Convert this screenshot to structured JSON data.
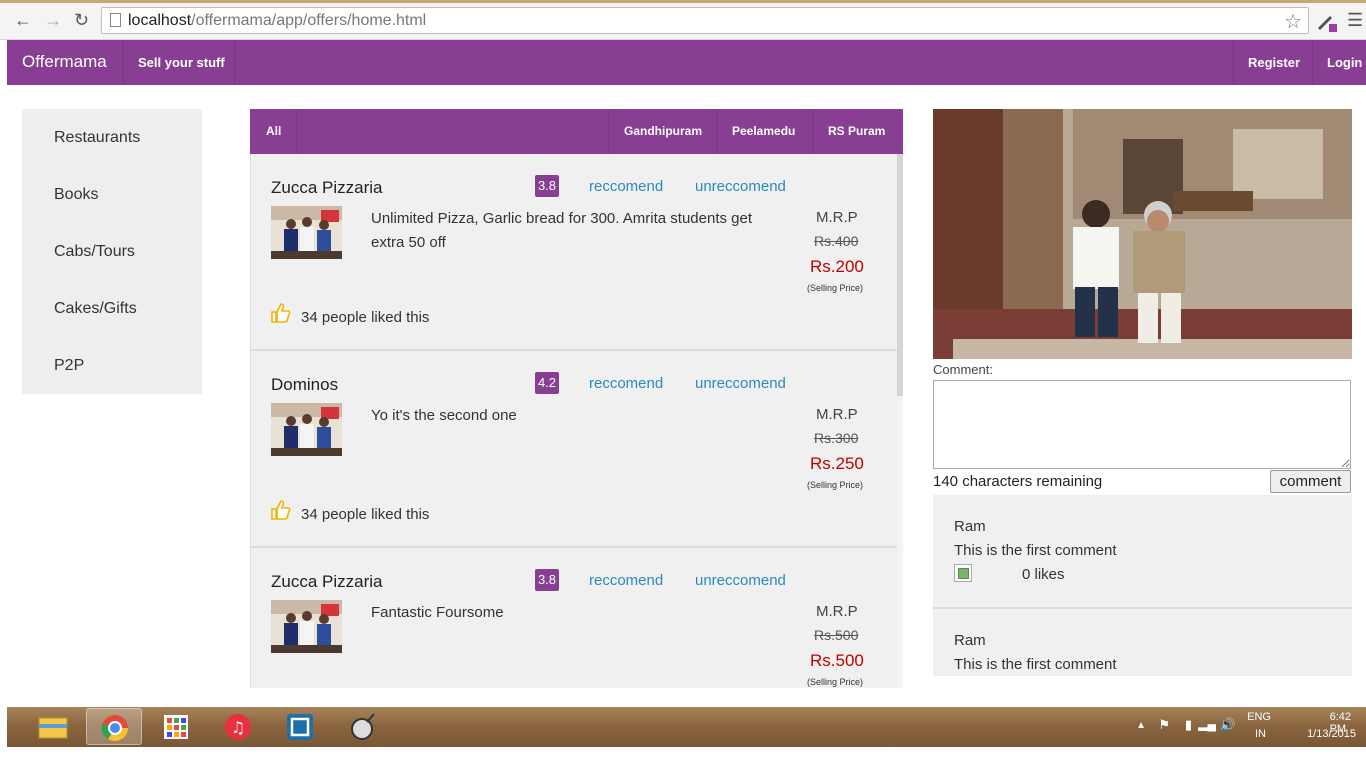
{
  "browser": {
    "url_host": "localhost",
    "url_path": "/offermama/app/offers/home.html"
  },
  "topnav": {
    "brand": "Offermama",
    "sell": "Sell your stuff",
    "register": "Register",
    "login": "Login",
    "color": "#883e93"
  },
  "categories": [
    "Restaurants",
    "Books",
    "Cabs/Tours",
    "Cakes/Gifts",
    "P2P"
  ],
  "filters": {
    "all": "All",
    "locations": [
      "Gandhipuram",
      "Peelamedu",
      "RS Puram"
    ]
  },
  "offers": [
    {
      "name": "Zucca Pizzaria",
      "rating": "3.8",
      "recommend": "reccomend",
      "unrecommend": "unreccomend",
      "description": "Unlimited Pizza, Garlic bread for 300. Amrita students get extra 50 off",
      "mrp_label": "M.R.P",
      "mrp": "Rs.400",
      "price": "Rs.200",
      "price_note": "(Selling Price)",
      "likes": "34 people liked this"
    },
    {
      "name": "Dominos",
      "rating": "4.2",
      "recommend": "reccomend",
      "unrecommend": "unreccomend",
      "description": "Yo it's the second one",
      "mrp_label": "M.R.P",
      "mrp": "Rs.300",
      "price": "Rs.250",
      "price_note": "(Selling Price)",
      "likes": "34 people liked this"
    },
    {
      "name": "Zucca Pizzaria",
      "rating": "3.8",
      "recommend": "reccomend",
      "unrecommend": "unreccomend",
      "description": "Fantastic Foursome",
      "mrp_label": "M.R.P",
      "mrp": "Rs.500",
      "price": "Rs.500",
      "price_note": "(Selling Price)",
      "likes": ""
    }
  ],
  "comment_form": {
    "label": "Comment:",
    "remaining": "140 characters remaining",
    "button": "comment",
    "value": ""
  },
  "comments": [
    {
      "author": "Ram",
      "text": "This is the first comment",
      "likes": "0 likes"
    },
    {
      "author": "Ram",
      "text": "This is the first comment",
      "likes": ""
    }
  ],
  "tray": {
    "lang": "ENG",
    "region": "IN",
    "time": "6:42 PM",
    "date": "1/13/2015"
  },
  "icons": {
    "back": "back-arrow-icon",
    "forward": "forward-arrow-icon",
    "reload": "reload-icon",
    "star": "bookmark-star-icon",
    "menu": "menu-icon",
    "thumbs_up": "thumbs-up-icon"
  }
}
